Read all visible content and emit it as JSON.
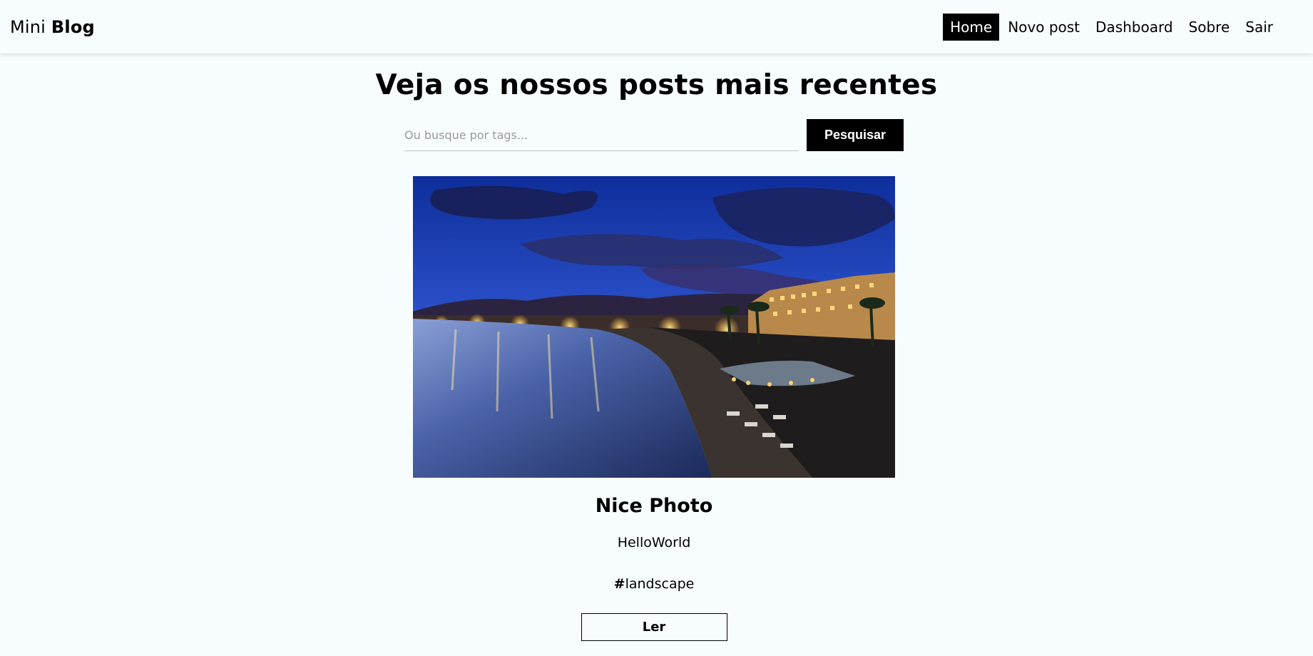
{
  "brand": {
    "light": "Mini",
    "bold": "Blog"
  },
  "nav": {
    "items": [
      {
        "label": "Home",
        "active": true
      },
      {
        "label": "Novo post",
        "active": false
      },
      {
        "label": "Dashboard",
        "active": false
      },
      {
        "label": "Sobre",
        "active": false
      }
    ],
    "logout": "Sair"
  },
  "page": {
    "title": "Veja os nossos posts mais recentes"
  },
  "search": {
    "placeholder": "Ou busque por tags...",
    "value": "",
    "button": "Pesquisar"
  },
  "posts": [
    {
      "image_desc": "night-seafront-photo",
      "title": "Nice Photo",
      "author": "HelloWorld",
      "tag_prefix": "#",
      "tag": "landscape",
      "read_button": "Ler"
    }
  ],
  "colors": {
    "background": "#f7fcff",
    "accent": "#000000",
    "active_text": "#ffffff"
  }
}
